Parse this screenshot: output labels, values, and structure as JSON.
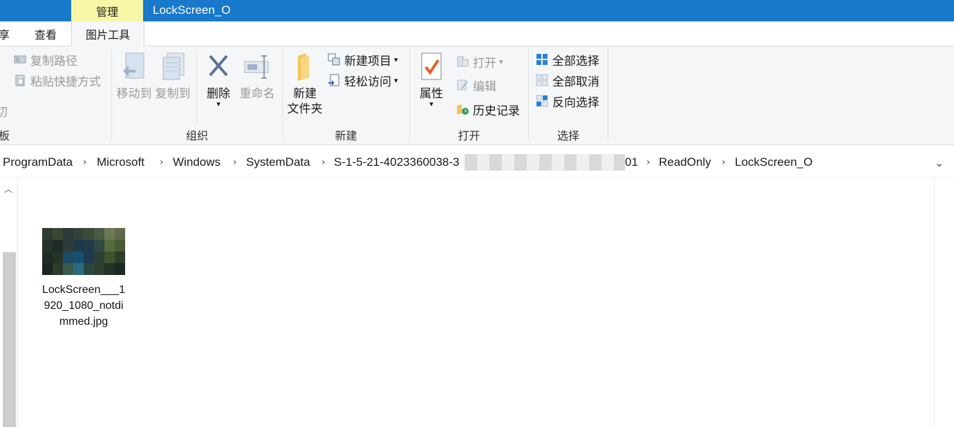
{
  "window": {
    "context_tab": "管理",
    "title": "LockScreen_O"
  },
  "tabs": {
    "share_partial": "享",
    "view": "查看",
    "picture_tools": "图片工具"
  },
  "ribbon": {
    "clipboard": {
      "copy_path": "复制路径",
      "paste_shortcut": "粘贴快捷方式",
      "cut_partial": "切",
      "group_partial": "板"
    },
    "organize": {
      "move_to": "移动到",
      "copy_to": "复制到",
      "delete": "删除",
      "rename": "重命名",
      "group_label": "组织"
    },
    "new": {
      "new_folder_line1": "新建",
      "new_folder_line2": "文件夹",
      "new_item": "新建项目",
      "easy_access": "轻松访问",
      "group_label": "新建"
    },
    "open": {
      "properties": "属性",
      "open": "打开",
      "edit": "编辑",
      "history": "历史记录",
      "group_label": "打开"
    },
    "select": {
      "select_all": "全部选择",
      "select_none": "全部取消",
      "invert": "反向选择",
      "group_label": "选择"
    }
  },
  "address": {
    "crumbs": [
      "ProgramData",
      "Microsoft",
      "Windows",
      "SystemData",
      "S-1-5-21-4023360038-3",
      "01",
      "ReadOnly",
      "LockScreen_O"
    ]
  },
  "files": [
    {
      "name": "LockScreen___1920_1080_notdimmed.jpg"
    }
  ],
  "colors": {
    "titlebar": "#1979ca",
    "context_tab": "#f7f5a6",
    "ribbon_bg": "#f5f6f7"
  }
}
